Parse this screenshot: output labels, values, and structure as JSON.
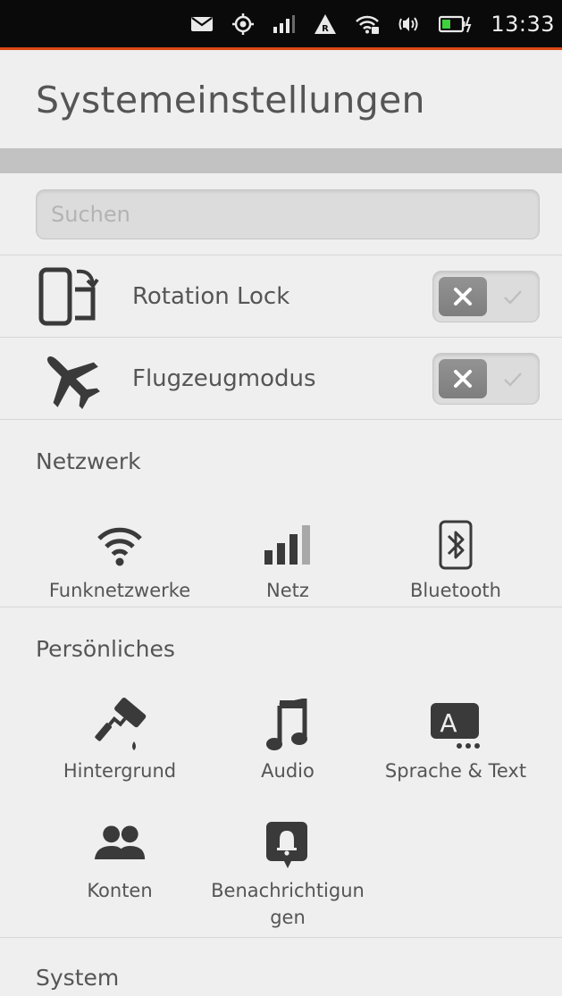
{
  "status_bar": {
    "icons": [
      "mail-icon",
      "location-icon",
      "cell-signal-icon",
      "roaming-icon",
      "wifi-icon",
      "volume-icon",
      "battery-charging-icon"
    ],
    "time": "13:33",
    "accent_color": "#dd4814"
  },
  "header": {
    "title": "Systemeinstellungen"
  },
  "search": {
    "placeholder": "Suchen",
    "value": ""
  },
  "toggles": [
    {
      "label": "Rotation Lock",
      "icon": "rotation-lock-icon",
      "enabled": false
    },
    {
      "label": "Flugzeugmodus",
      "icon": "airplane-icon",
      "enabled": false
    }
  ],
  "sections": {
    "network": {
      "title": "Netzwerk",
      "items": [
        {
          "label": "Funknetzwerke",
          "icon": "wifi-icon"
        },
        {
          "label": "Netz",
          "icon": "cell-signal-icon"
        },
        {
          "label": "Bluetooth",
          "icon": "bluetooth-icon"
        }
      ]
    },
    "personal": {
      "title": "Persönliches",
      "items": [
        {
          "label": "Hintergrund",
          "icon": "paint-roller-icon"
        },
        {
          "label": "Audio",
          "icon": "music-note-icon"
        },
        {
          "label": "Sprache & Text",
          "icon": "keyboard-language-icon"
        },
        {
          "label": "Konten",
          "icon": "accounts-icon"
        },
        {
          "label": "Benachrichtigungen",
          "icon": "notification-bell-icon"
        }
      ]
    },
    "system": {
      "title": "System"
    }
  }
}
